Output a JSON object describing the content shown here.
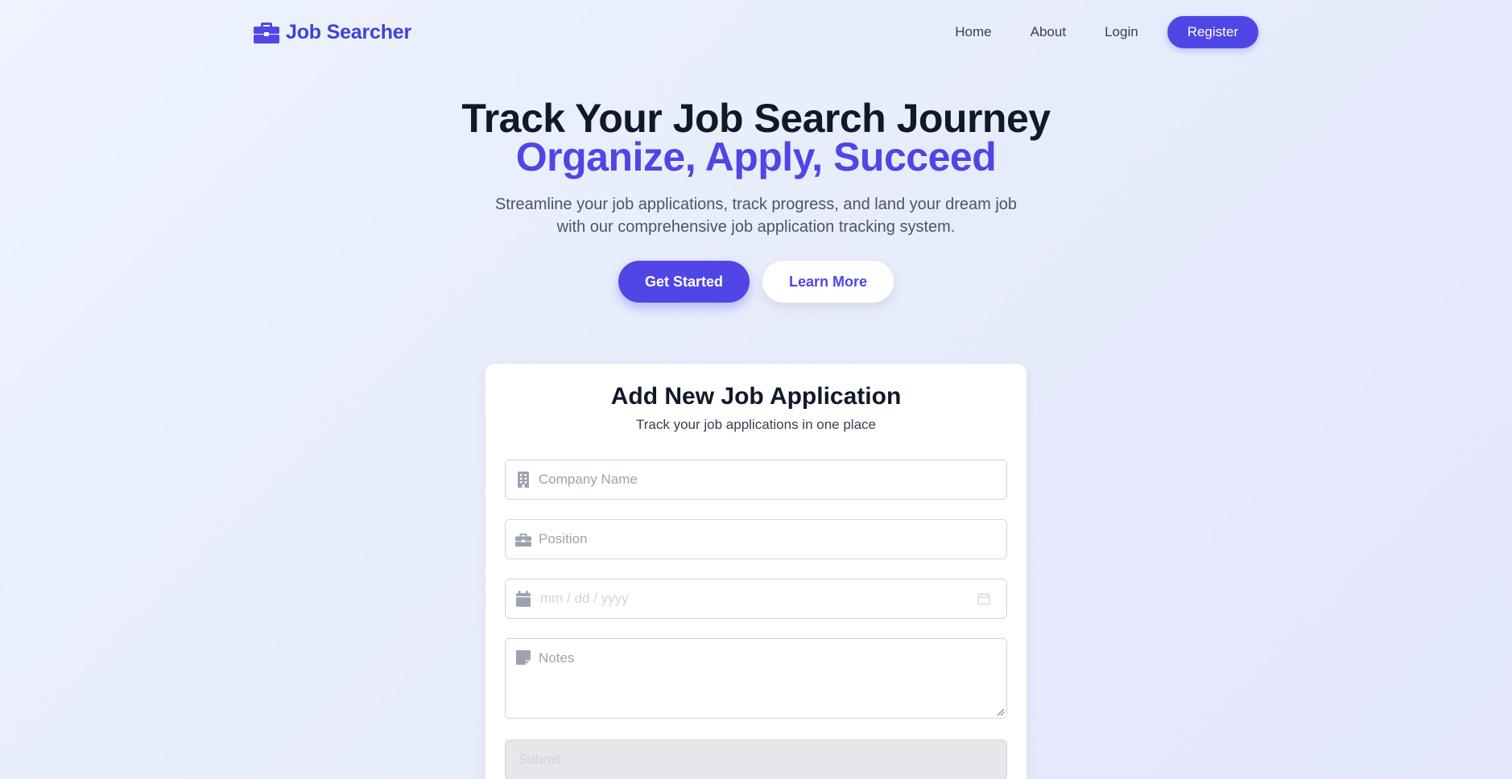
{
  "nav": {
    "brand": "Job Searcher",
    "brand_icon": "briefcase-icon",
    "links": [
      "Home",
      "About",
      "Login"
    ],
    "register_label": "Register"
  },
  "hero": {
    "title": "Track Your Job Search Journey",
    "subtitle": "Organize, Apply, Succeed",
    "description": "Streamline your job applications, track progress, and land your dream job with our comprehensive job application tracking system.",
    "primary_cta": "Get Started",
    "secondary_cta": "Learn More"
  },
  "form": {
    "title": "Add New Job Application",
    "subtitle": "Track your job applications in one place",
    "company_placeholder": "Company Name",
    "company_icon": "building-icon",
    "position_placeholder": "Position",
    "position_icon": "briefcase-icon",
    "date_placeholder": "mm / dd / yyyy",
    "date_icon": "calendar-icon",
    "notes_placeholder": "Notes",
    "notes_icon": "note-icon",
    "submit_label": "Submit"
  },
  "colors": {
    "accent": "#4f46e5",
    "brand": "#4042d6",
    "text": "#111827",
    "muted": "#4b5563"
  }
}
